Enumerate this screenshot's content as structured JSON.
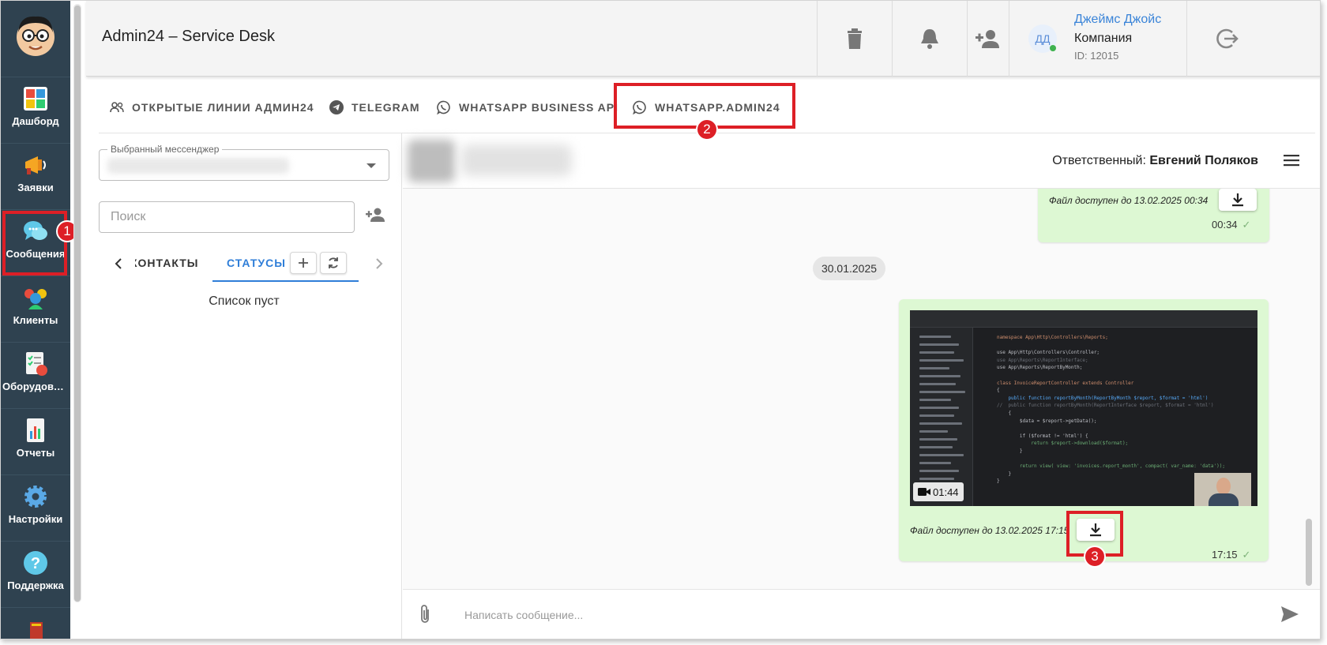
{
  "app": {
    "title": "Admin24 – Service Desk"
  },
  "sidebar": {
    "items": [
      {
        "label": "Дашборд"
      },
      {
        "label": "Заявки"
      },
      {
        "label": "Сообщения"
      },
      {
        "label": "Клиенты"
      },
      {
        "label": "Оборудован..."
      },
      {
        "label": "Отчеты"
      },
      {
        "label": "Настройки"
      },
      {
        "label": "Поддержка"
      }
    ]
  },
  "user": {
    "name": "Джеймс Джойс",
    "company": "Компания",
    "id": "ID: 12015",
    "initials": "ДД"
  },
  "tabs": [
    {
      "label": "ОТКРЫТЫЕ ЛИНИИ АДМИН24"
    },
    {
      "label": "TELEGRAM"
    },
    {
      "label": "WHATSAPP BUSINESS API"
    },
    {
      "label": "WHATSAPP.ADMIN24"
    }
  ],
  "left_panel": {
    "select_legend": "Выбранный мессенджер",
    "search_placeholder": "Поиск",
    "subtabs": {
      "contacts": "КОНТАКТЫ",
      "statuses": "СТАТУСЫ"
    },
    "empty_text": "Список пуст"
  },
  "chat": {
    "responsible_label": "Ответственный:",
    "responsible_name": "Евгений Поляков",
    "messages": [
      {
        "file_note": "Файл доступен до 13.02.2025 00:34",
        "time": "00:34"
      },
      {
        "date": "30.01.2025"
      },
      {
        "video_duration": "01:44",
        "file_note": "Файл доступен до 13.02.2025 17:15",
        "time": "17:15"
      }
    ],
    "composer_placeholder": "Написать сообщение..."
  },
  "annotations": {
    "badge1": "1",
    "badge2": "2",
    "badge3": "3"
  },
  "video_code": {
    "l1": "namespace App\\Http\\Controllers\\Reports;",
    "l2": "use App\\Http\\Controllers\\Controller;",
    "l3": "use App\\Reports\\ReportInterface;",
    "l4": "use App\\Reports\\ReportByMonth;",
    "l5": "class InvoiceReportController extends Controller",
    "l6": "{",
    "l7": "    public function reportByMonth(ReportByMonth $report, $format = 'html')",
    "l8": "//  public function reportByMonth(ReportInterface $report, $format = 'html')",
    "l9": "    {",
    "l10": "        $data = $report->getData();",
    "l11": "        if ($format != 'html') {",
    "l12": "            return $report->download($format);",
    "l13": "        }",
    "l14": "        return view( view: 'invoices.report_month', compact( var_name: 'data'));",
    "l15": "    }",
    "l16": "}"
  },
  "colors": {
    "sidebar_bg": "#2f4250",
    "accent": "#2f7ed8",
    "bubble": "#ddf8d3",
    "callout": "#dd1f26"
  }
}
